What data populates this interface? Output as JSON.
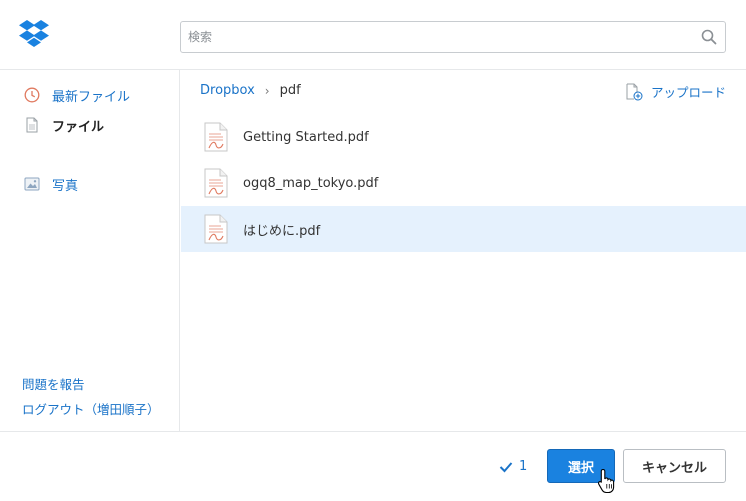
{
  "header": {
    "logo_icon": "dropbox-logo-icon",
    "search": {
      "placeholder": "検索",
      "value": "",
      "icon": "search-icon"
    }
  },
  "sidebar": {
    "items": [
      {
        "label": "最新ファイル",
        "icon": "clock-icon",
        "active": false
      },
      {
        "label": "ファイル",
        "icon": "file-icon",
        "active": true
      },
      {
        "label": "写真",
        "icon": "photo-icon",
        "active": false
      }
    ],
    "links": [
      {
        "label": "問題を報告"
      },
      {
        "label": "ログアウト（増田順子）"
      }
    ]
  },
  "main": {
    "breadcrumb": {
      "root": "Dropbox",
      "separator": "›",
      "current": "pdf"
    },
    "upload_label": "アップロード",
    "files": [
      {
        "name": "Getting Started.pdf",
        "icon": "pdf-file-icon",
        "selected": false
      },
      {
        "name": "ogq8_map_tokyo.pdf",
        "icon": "pdf-file-icon",
        "selected": false
      },
      {
        "name": "はじめに.pdf",
        "icon": "pdf-file-icon",
        "selected": true
      }
    ]
  },
  "footer": {
    "selected_count": "1",
    "select_label": "選択",
    "cancel_label": "キャンセル"
  },
  "colors": {
    "accent": "#1a73c8",
    "primary_button": "#1a82e0",
    "selected_row": "#e5f1fd",
    "divider": "#e6e8ea",
    "pdf_icon_accent": "#e07a60"
  }
}
